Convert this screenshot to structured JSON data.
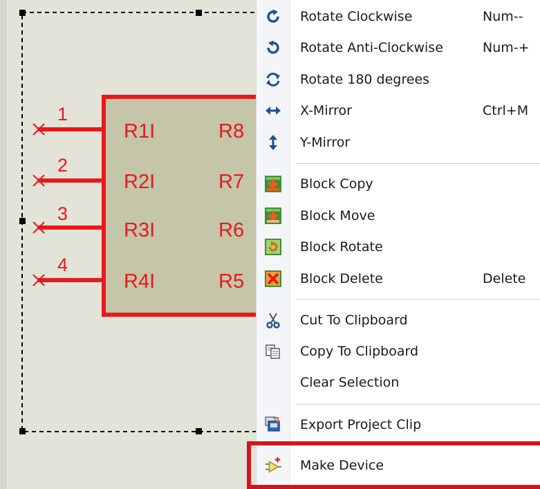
{
  "schematic": {
    "part_labels_left": [
      "R1I",
      "R2I",
      "R3I",
      "R4I"
    ],
    "part_labels_right": [
      "R8",
      "R7",
      "R6",
      "R5"
    ],
    "pin_numbers": [
      "1",
      "2",
      "3",
      "4"
    ]
  },
  "menu": {
    "rotate_cw": {
      "label": "Rotate Clockwise",
      "shortcut": "Num--",
      "icon": "rotate-cw-icon"
    },
    "rotate_acw": {
      "label": "Rotate Anti-Clockwise",
      "shortcut": "Num-+",
      "icon": "rotate-acw-icon"
    },
    "rotate_180": {
      "label": "Rotate 180 degrees",
      "icon": "rotate-180-icon"
    },
    "x_mirror": {
      "label": "X-Mirror",
      "shortcut": "Ctrl+M",
      "icon": "x-mirror-icon"
    },
    "y_mirror": {
      "label": "Y-Mirror",
      "icon": "y-mirror-icon"
    },
    "block_copy": {
      "label": "Block Copy",
      "icon": "block-copy-icon"
    },
    "block_move": {
      "label": "Block Move",
      "icon": "block-move-icon"
    },
    "block_rotate": {
      "label": "Block Rotate",
      "icon": "block-rotate-icon"
    },
    "block_delete": {
      "label": "Block Delete",
      "shortcut": "Delete",
      "icon": "block-delete-icon"
    },
    "cut": {
      "label": "Cut To Clipboard",
      "icon": "scissors-icon"
    },
    "copy": {
      "label": "Copy To Clipboard",
      "icon": "copy-icon"
    },
    "clear": {
      "label": "Clear Selection"
    },
    "export": {
      "label": "Export Project Clip",
      "icon": "export-icon"
    },
    "make_device": {
      "label": "Make Device",
      "icon": "make-device-icon"
    }
  },
  "colors": {
    "schematic_background": "#e3e3d8",
    "component_fill": "#c5c5a8",
    "wire_red": "#e8191c",
    "icon_blue": "#1f4f95",
    "highlight_red": "#d5151d"
  }
}
